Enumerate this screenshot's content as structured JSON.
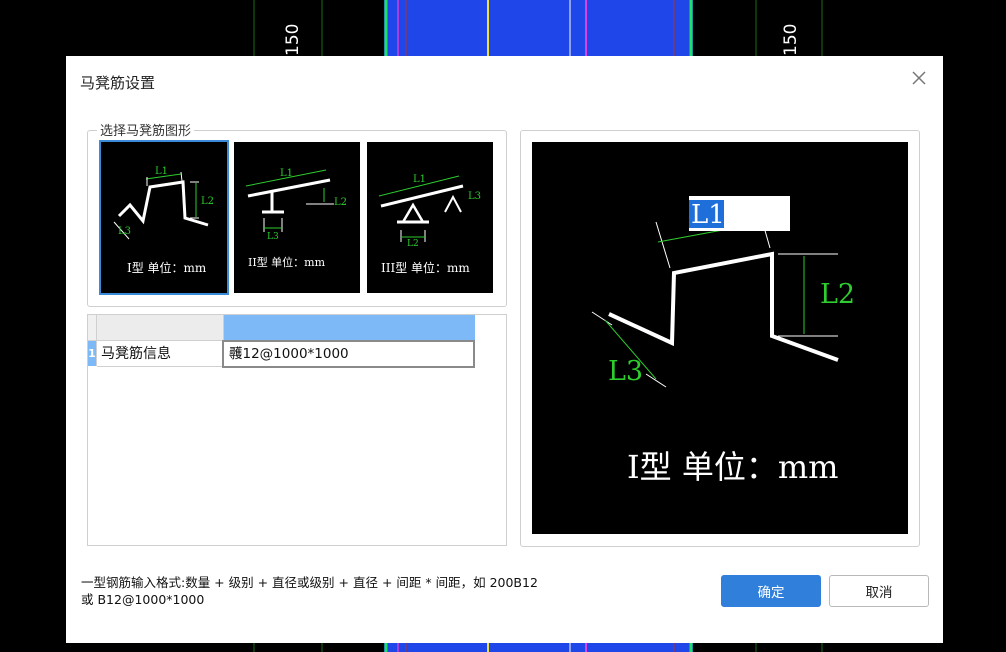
{
  "background": {
    "dimension_label_left": "150",
    "dimension_label_right": "150"
  },
  "dialog": {
    "title": "马凳筋设置",
    "group_label": "选择马凳筋图形",
    "shapes": [
      {
        "caption": "I型  单位：mm",
        "selected": true
      },
      {
        "caption": "II型  单位：mm",
        "selected": false
      },
      {
        "caption": "III型  单位：mm",
        "selected": false
      }
    ],
    "shape_dim_labels": {
      "l1": "L1",
      "l2": "L2",
      "l3": "L3"
    },
    "table": {
      "header_col1": "",
      "header_col2": "",
      "rows": [
        {
          "index": "1",
          "name": "马凳筋信息",
          "value": "彠12@1000*1000"
        }
      ]
    },
    "preview": {
      "l1_input": "L1",
      "l2_label": "L2",
      "l3_label": "L3",
      "caption": "I型  单位：mm"
    },
    "hint_line1": "一型钢筋输入格式:数量 + 级别 + 直径或级别 + 直径 + 间距 * 间距，如 200B12",
    "hint_line2": "或 B12@1000*1000",
    "ok_label": "确定",
    "cancel_label": "取消"
  },
  "colors": {
    "accent": "#2f7fdb",
    "header_blue": "#7db8f7",
    "dim_green": "#2ecc2e",
    "canvas_blue": "#1e46e8"
  }
}
